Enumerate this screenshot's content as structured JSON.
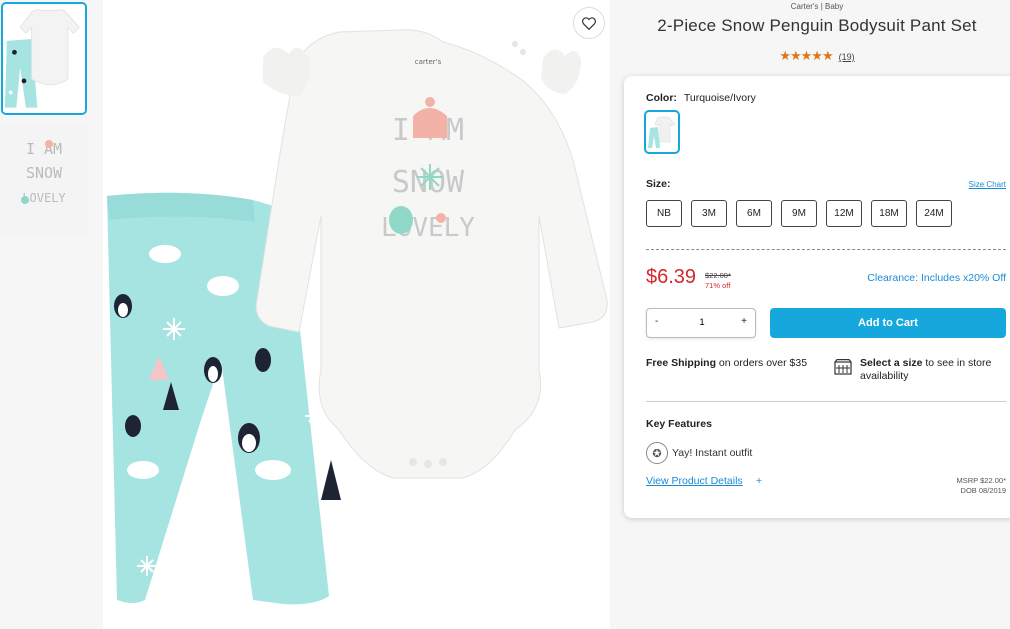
{
  "header": {
    "brand": "Carter's | Baby",
    "title": "2-Piece Snow Penguin Bodysuit Pant Set",
    "stars": "★★★★★",
    "review_count": "(19)"
  },
  "color": {
    "label": "Color:",
    "value": "Turquoise/Ivory"
  },
  "size": {
    "label": "Size:",
    "chart_link": "Size Chart",
    "options": [
      "NB",
      "3M",
      "6M",
      "9M",
      "12M",
      "18M",
      "24M"
    ]
  },
  "pricing": {
    "price": "$6.39",
    "was": "$22.00*",
    "discount": "71% off",
    "clearance": "Clearance: Includes x20% Off"
  },
  "cart": {
    "minus": "-",
    "quantity": "1",
    "plus": "+",
    "add_label": "Add to Cart"
  },
  "shipping": {
    "bold": "Free Shipping",
    "rest": " on orders over $35"
  },
  "store": {
    "bold": "Select a size",
    "rest": " to see in store availability"
  },
  "features": {
    "title": "Key Features",
    "item": "Yay! Instant outfit"
  },
  "details": {
    "link": "View Product Details",
    "plus": "+",
    "msrp": "MSRP $22.00*",
    "dob": "DOB 08/2019"
  },
  "product_art": {
    "tag": "carter's",
    "line1": "I AM",
    "line2": "SNOW",
    "line3": "LOVELY"
  },
  "colors": {
    "accent": "#16a8dc",
    "price_red": "#d6272b",
    "star_orange": "#e0761a",
    "link_blue": "#1a8bd6",
    "pant_turquoise": "#a6e4e2"
  }
}
